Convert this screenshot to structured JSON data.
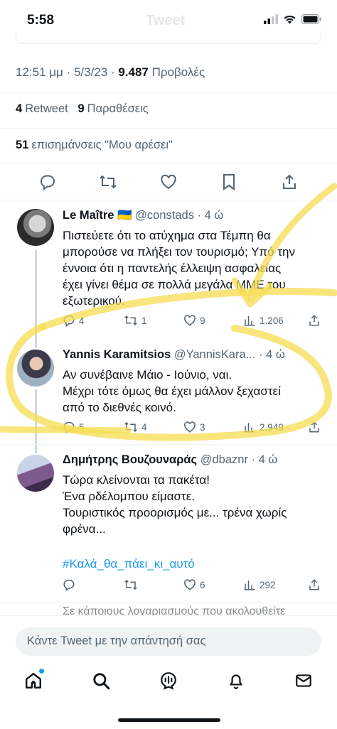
{
  "status": {
    "time": "5:58"
  },
  "nav": {
    "title": "Tweet"
  },
  "tweet": {
    "time": "12:51 μμ",
    "date": "5/3/23",
    "views_count": "9.487",
    "views_label": "Προβολές",
    "retweets_count": "4",
    "retweets_label": "Retweet",
    "quotes_count": "9",
    "quotes_label": "Παραθέσεις",
    "likes_count": "51",
    "likes_label": "επισημάνσεις \"Μου αρέσει\""
  },
  "replies": [
    {
      "name": "Le Maître",
      "flag": "🇺🇦",
      "handle": "@constads",
      "time": "4 ώ",
      "lines": [
        "Πιστεύετε ότι το ατύχημα στα Τέμπη θα",
        "μπορούσε να πλήξει τον τουρισμό; Υπό την",
        "έννοια ότι η παντελής έλλειψη ασφαλείας",
        "έχει γίνει θέμα σε πολλά μεγάλα ΜΜΕ του",
        "εξωτερικού."
      ],
      "replies": "4",
      "retweets": "1",
      "likes": "9",
      "views": "1.206"
    },
    {
      "name": "Yannis Karamitsios",
      "handle": "@YannisKara...",
      "time": "4 ώ",
      "lines": [
        "Αν συνέβαινε Μάιο - Ιούνιο, ναι.",
        "Μέχρι τότε όμως θα έχει μάλλον ξεχαστεί",
        "από το διεθνές κοινό."
      ],
      "replies": "5",
      "retweets": "4",
      "likes": "3",
      "views": "2.949"
    },
    {
      "name": "Δημήτρης Βουζουναράς",
      "handle": "@dbaznr",
      "time": "4 ώ",
      "lines": [
        "Τώρα κλείνονται τα πακέτα!",
        "Ένα ρδέλομπου είμαστε.",
        "Τουριστικός προορισμός με... τρένα χωρίς",
        "φρένα..."
      ],
      "hashtag": "#Καλά_θα_πάει_κι_αυτό",
      "replies": "",
      "retweets": "",
      "likes": "6",
      "views": "292"
    }
  ],
  "peek": "Σε κάποιους λογαριασμούς που ακολουθείτε",
  "compose": {
    "placeholder": "Κάντε Tweet με την απάντησή σας"
  },
  "colors": {
    "accent": "#1d9bf0",
    "highlight": "#f5dc50",
    "muted": "#536471"
  },
  "icons": [
    "home-icon",
    "search-icon",
    "spaces-icon",
    "notifications-icon",
    "messages-icon"
  ]
}
